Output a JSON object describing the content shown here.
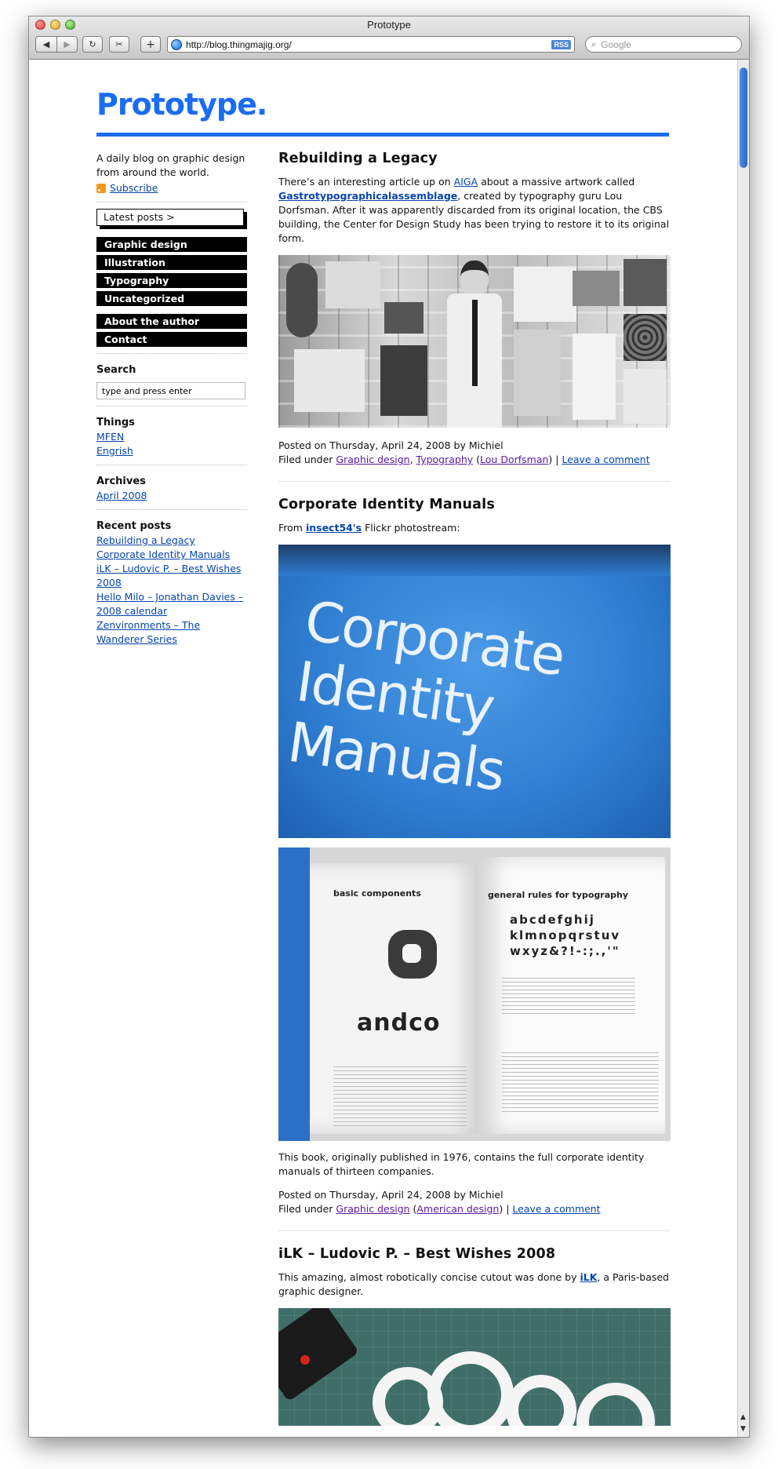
{
  "browser": {
    "title": "Prototype",
    "url": "http://blog.thingmajig.org/",
    "rss_label": "RSS",
    "search_placeholder": "Google"
  },
  "site": {
    "logo": "Prototype.",
    "tagline": "A daily blog on graphic design from around the world.",
    "subscribe": "Subscribe",
    "brand_color": "#1a6cf0"
  },
  "sidebar": {
    "latest_posts": "Latest posts >",
    "categories": [
      "Graphic design",
      "Illustration",
      "Typography",
      "Uncategorized"
    ],
    "pages": [
      "About the author",
      "Contact"
    ],
    "search_heading": "Search",
    "search_value": "type and press enter",
    "things_heading": "Things",
    "things": [
      "MFEN",
      "Engrish"
    ],
    "archives_heading": "Archives",
    "archives": [
      "April 2008"
    ],
    "recent_heading": "Recent posts",
    "recent": [
      "Rebuilding a Legacy",
      "Corporate Identity Manuals",
      "iLK – Ludovic P. – Best Wishes 2008",
      "Hello Milo – Jonathan Davies – 2008 calendar",
      "Zenvironments – The Wanderer Series"
    ]
  },
  "posts": [
    {
      "title": "Rebuilding a Legacy",
      "body_1": "There’s an interesting article up on ",
      "link_1": "AIGA",
      "body_2": " about a massive artwork called ",
      "link_2": "Gastrotypographicalassemblage",
      "body_3": ", created by typography guru Lou Dorfsman. After it was apparently discarded from its original location, the CBS building, the Center for Design Study has been trying to restore it to its original form.",
      "posted": "Posted on Thursday, April 24, 2008 by Michiel",
      "filed": "Filed under ",
      "cat_1": "Graphic design",
      "cat_2": "Typography",
      "tag": "Lou Dorfsman",
      "comment": "Leave a comment"
    },
    {
      "title": "Corporate Identity Manuals",
      "intro_1": "From ",
      "intro_link": "insect54's",
      "intro_2": " Flickr photostream:",
      "cover_line_1": "Corporate",
      "cover_line_2": "Identity",
      "cover_line_3": "Manuals",
      "book_left_heading": "basic components",
      "book_right_heading": "general rules for typography",
      "book_wordmark": "andco",
      "book_alphabet": "abcdefghij klmnopqrstuv wxyz&?!-:;.,'\"",
      "caption": "This book, originally published in 1976, contains the full corporate identity manuals of thirteen companies.",
      "posted": "Posted on Thursday, April 24, 2008 by Michiel",
      "filed": "Filed under ",
      "cat_1": "Graphic design",
      "tag": "American design",
      "comment": "Leave a comment"
    },
    {
      "title": "iLK – Ludovic P. – Best Wishes 2008",
      "body_1": "This amazing, almost robotically concise cutout was done by ",
      "link_1": "iLK",
      "body_2": ", a Paris-based graphic designer."
    }
  ]
}
